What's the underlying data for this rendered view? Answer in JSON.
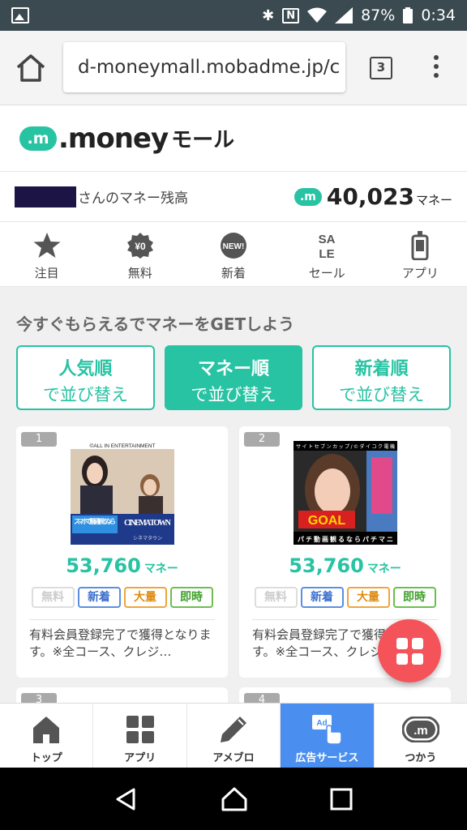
{
  "status": {
    "battery": "87%",
    "time": "0:34"
  },
  "browser": {
    "url": "d-moneymall.mobadme.jp/c",
    "tab_count": "3"
  },
  "site": {
    "logo_mark": ".m",
    "logo_name": ".money",
    "logo_suffix": "モール"
  },
  "balance": {
    "label": "さんのマネー残高",
    "coin": ".m",
    "value": "40,023",
    "unit": "マネー"
  },
  "categories": [
    {
      "label": "注目",
      "icon": "star-icon"
    },
    {
      "label": "無料",
      "icon": "free-yen-icon"
    },
    {
      "label": "新着",
      "icon": "new-badge-icon"
    },
    {
      "label": "セール",
      "icon": "sale-icon"
    },
    {
      "label": "アプリ",
      "icon": "phone-icon"
    }
  ],
  "section_title": "今すぐもらえるでマネーをGETしよう",
  "sort": [
    {
      "line1": "人気順",
      "line2": "で並び替え",
      "active": false
    },
    {
      "line1": "マネー順",
      "line2": "で並び替え",
      "active": true
    },
    {
      "line1": "新着順",
      "line2": "で並び替え",
      "active": false
    }
  ],
  "cards": [
    {
      "rank": "1",
      "thumb_top": "©ALL IN ENTERTAINMENT",
      "thumb_left": "スマホで動画観るなら",
      "thumb_right": "CINEMA TOWN",
      "thumb_small": "シネマタウン",
      "money": "53,760",
      "unit": "マネー",
      "tags": [
        "無料",
        "新着",
        "大量",
        "即時"
      ],
      "desc": "有料会員登録完了で獲得となります。※全コース、クレジ…"
    },
    {
      "rank": "2",
      "thumb_top": "サイトセブンカップ/©ダイコク電機",
      "thumb_goal": "GOAL",
      "thumb_bottom": "パチ動画観るならパチマニ",
      "money": "53,760",
      "unit": "マネー",
      "tags": [
        "無料",
        "新着",
        "大量",
        "即時"
      ],
      "desc": "有料会員登録完了で獲得となります。※全コース、クレジ…"
    }
  ],
  "next_ranks": [
    "3",
    "4"
  ],
  "bottom_nav": [
    {
      "label": "トップ",
      "icon": "home-icon"
    },
    {
      "label": "アプリ",
      "icon": "apps-grid-icon"
    },
    {
      "label": "アメブロ",
      "icon": "pen-icon"
    },
    {
      "label": "広告サービス",
      "icon": "ad-tap-icon",
      "active": true,
      "icon_text": "Ad"
    },
    {
      "label": "つかう",
      "icon": "money-coin-icon",
      "icon_text": ".m"
    }
  ],
  "colors": {
    "brand": "#27c3a3",
    "active_nav": "#4a8ff0",
    "fab": "#f5535a"
  }
}
